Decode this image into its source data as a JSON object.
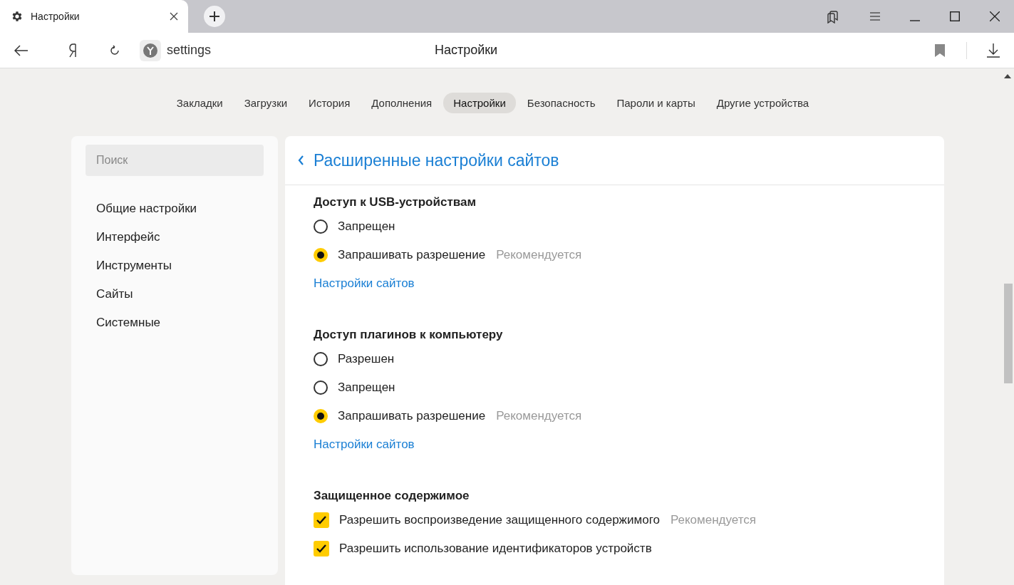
{
  "browser": {
    "tab": {
      "title": "Настройки"
    },
    "address": "settings",
    "page_title": "Настройки"
  },
  "nav": [
    {
      "label": "Закладки",
      "selected": false
    },
    {
      "label": "Загрузки",
      "selected": false
    },
    {
      "label": "История",
      "selected": false
    },
    {
      "label": "Дополнения",
      "selected": false
    },
    {
      "label": "Настройки",
      "selected": true
    },
    {
      "label": "Безопасность",
      "selected": false
    },
    {
      "label": "Пароли и карты",
      "selected": false
    },
    {
      "label": "Другие устройства",
      "selected": false
    }
  ],
  "sidebar": {
    "search": {
      "placeholder": "Поиск"
    },
    "items": [
      "Общие настройки",
      "Интерфейс",
      "Инструменты",
      "Сайты",
      "Системные"
    ]
  },
  "panel": {
    "title": "Расширенные настройки сайтов",
    "sections": [
      {
        "title": "Доступ к USB-устройствам",
        "options": [
          {
            "kind": "radio",
            "label": "Запрещен",
            "selected": false
          },
          {
            "kind": "radio",
            "label": "Запрашивать разрешение",
            "note": "Рекомендуется",
            "selected": true
          }
        ],
        "link": "Настройки сайтов"
      },
      {
        "title": "Доступ плагинов к компьютеру",
        "options": [
          {
            "kind": "radio",
            "label": "Разрешен",
            "selected": false
          },
          {
            "kind": "radio",
            "label": "Запрещен",
            "selected": false
          },
          {
            "kind": "radio",
            "label": "Запрашивать разрешение",
            "note": "Рекомендуется",
            "selected": true
          }
        ],
        "link": "Настройки сайтов"
      },
      {
        "title": "Защищенное содержимое",
        "options": [
          {
            "kind": "checkbox",
            "label": "Разрешить воспроизведение защищенного содержимого",
            "note": "Рекомендуется",
            "checked": true
          },
          {
            "kind": "checkbox",
            "label": "Разрешить использование идентификаторов устройств",
            "checked": true
          }
        ]
      }
    ]
  }
}
